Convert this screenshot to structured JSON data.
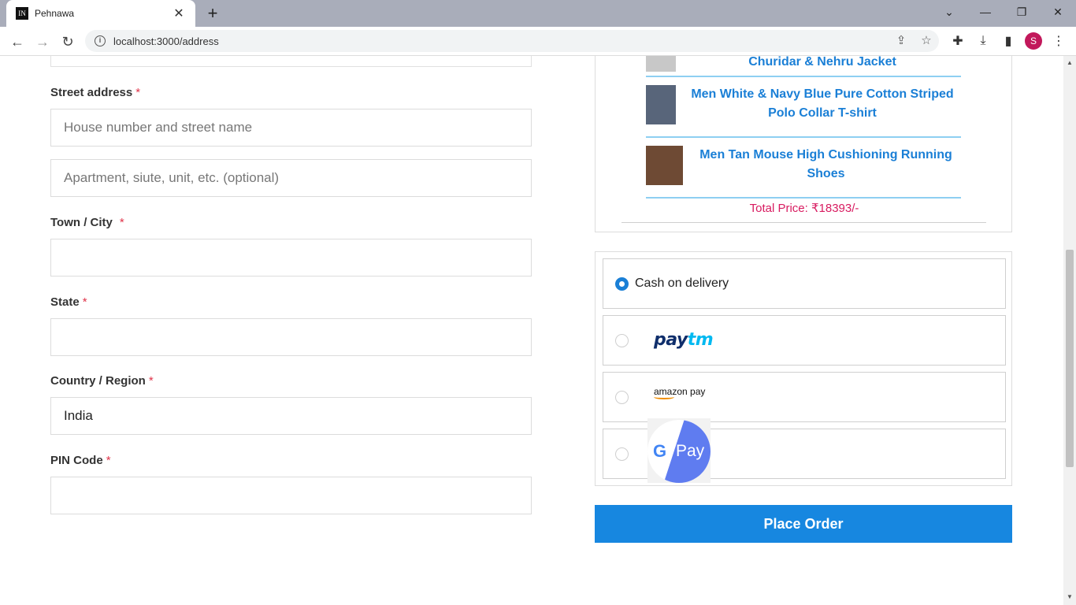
{
  "browser": {
    "tab_title": "Pehnawa",
    "tab_favicon": "IN",
    "url": "localhost:3000/address",
    "profile_initial": "S"
  },
  "form": {
    "street_label": "Street address",
    "street_placeholder": "House number and street name",
    "apartment_placeholder": "Apartment, siute, unit, etc. (optional)",
    "city_label": "Town / City",
    "state_label": "State",
    "country_label": "Country / Region",
    "country_value": "India",
    "pin_label": "PIN Code",
    "required_mark": "*"
  },
  "summary": {
    "items": [
      {
        "name": "Churidar & Nehru Jacket"
      },
      {
        "name": "Men White & Navy Blue Pure Cotton Striped Polo Collar T-shirt"
      },
      {
        "name": "Men Tan Mouse High Cushioning Running Shoes"
      }
    ],
    "total": "Total Price: ₹18393/-"
  },
  "payment": {
    "cod_label": "Cash on delivery",
    "paytm_p1": "pay",
    "paytm_p2": "tm",
    "amazon_label": "amazon pay",
    "gpay_g": "G",
    "gpay_label": "Pay",
    "selected": "cod"
  },
  "place_order_label": "Place Order"
}
